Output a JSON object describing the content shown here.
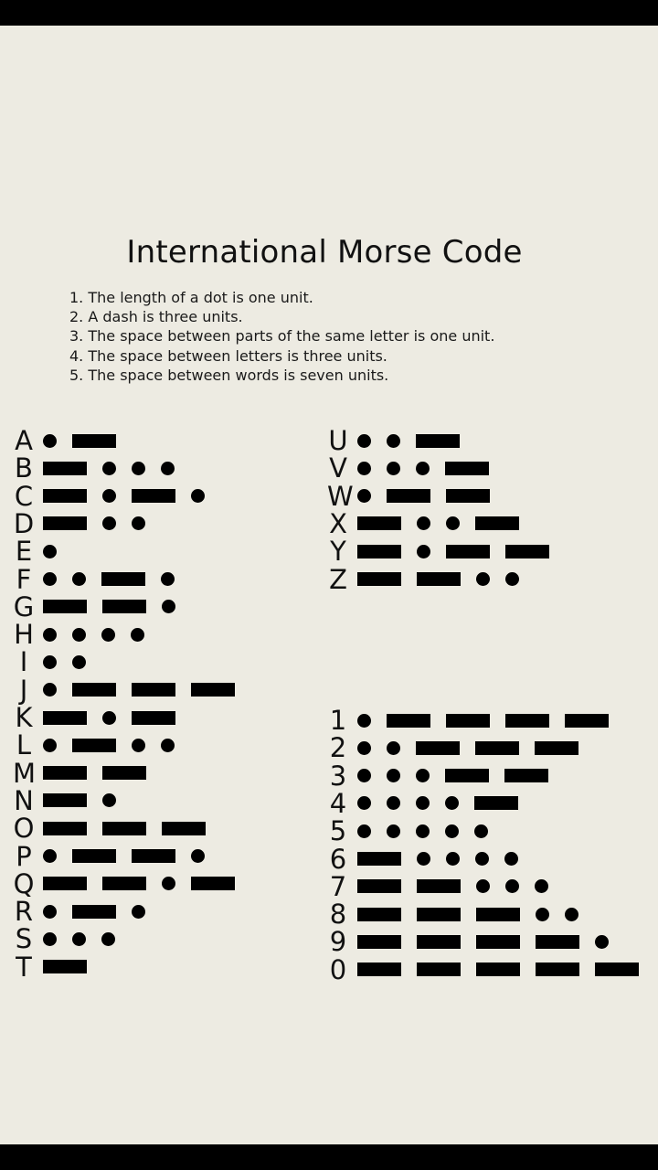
{
  "title": "International Morse Code",
  "rules": [
    {
      "num": "1.",
      "text": "The length of a dot is one unit."
    },
    {
      "num": "2.",
      "text": "A dash is three units."
    },
    {
      "num": "3.",
      "text": "The space between parts of the same letter is one unit."
    },
    {
      "num": "4.",
      "text": "The space between letters is three units."
    },
    {
      "num": "5.",
      "text": "The space between words is seven units."
    }
  ],
  "letters_left": [
    {
      "char": "A",
      "code": ".-"
    },
    {
      "char": "B",
      "code": "-..."
    },
    {
      "char": "C",
      "code": "-.-."
    },
    {
      "char": "D",
      "code": "-.."
    },
    {
      "char": "E",
      "code": "."
    },
    {
      "char": "F",
      "code": "..-."
    },
    {
      "char": "G",
      "code": "--."
    },
    {
      "char": "H",
      "code": "...."
    },
    {
      "char": "I",
      "code": ".."
    },
    {
      "char": "J",
      "code": ".---"
    },
    {
      "char": "K",
      "code": "-.-"
    },
    {
      "char": "L",
      "code": ".-.."
    },
    {
      "char": "M",
      "code": "--"
    },
    {
      "char": "N",
      "code": "-."
    },
    {
      "char": "O",
      "code": "---"
    },
    {
      "char": "P",
      "code": ".--."
    },
    {
      "char": "Q",
      "code": "--.-"
    },
    {
      "char": "R",
      "code": ".-."
    },
    {
      "char": "S",
      "code": "..."
    },
    {
      "char": "T",
      "code": "-"
    }
  ],
  "letters_right": [
    {
      "char": "U",
      "code": "..-"
    },
    {
      "char": "V",
      "code": "...-"
    },
    {
      "char": "W",
      "code": ".--"
    },
    {
      "char": "X",
      "code": "-..-"
    },
    {
      "char": "Y",
      "code": "-.--"
    },
    {
      "char": "Z",
      "code": "--.."
    }
  ],
  "numbers": [
    {
      "char": "1",
      "code": ".----"
    },
    {
      "char": "2",
      "code": "..---"
    },
    {
      "char": "3",
      "code": "...--"
    },
    {
      "char": "4",
      "code": "....-"
    },
    {
      "char": "5",
      "code": "....."
    },
    {
      "char": "6",
      "code": "-...."
    },
    {
      "char": "7",
      "code": "--..."
    },
    {
      "char": "8",
      "code": "---.."
    },
    {
      "char": "9",
      "code": "----."
    },
    {
      "char": "0",
      "code": "-----"
    }
  ],
  "colors": {
    "paper": "#edebe2",
    "ink": "#000000",
    "frame": "#000000"
  }
}
